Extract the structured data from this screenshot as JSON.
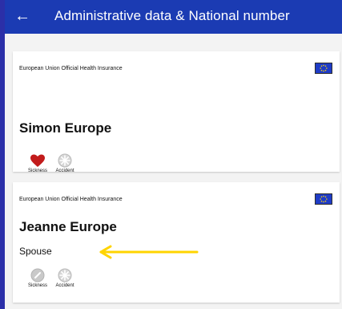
{
  "header": {
    "back_icon": "arrow-left-icon",
    "title": "Administrative data & National number"
  },
  "cards": [
    {
      "insurance": "European Union Official Health Insurance",
      "name": "Simon Europe",
      "relation": "",
      "icons": [
        {
          "label": "Sickness",
          "icon": "heart-icon",
          "state": "active",
          "color": "#c21b1b"
        },
        {
          "label": "Accident",
          "icon": "accident-icon",
          "state": "inactive",
          "color": "#b9b9b9"
        }
      ]
    },
    {
      "insurance": "European Union Official Health Insurance",
      "name": "Jeanne Europe",
      "relation": "Spouse",
      "icons": [
        {
          "label": "Sickness",
          "icon": "sickness-icon",
          "state": "inactive",
          "color": "#b9b9b9"
        },
        {
          "label": "Accident",
          "icon": "accident-icon",
          "state": "inactive",
          "color": "#b9b9b9"
        }
      ]
    }
  ],
  "colors": {
    "header_bg": "#1b3bb3",
    "accent_yellow": "#ffd400",
    "eu_blue": "#1f3cc7"
  }
}
